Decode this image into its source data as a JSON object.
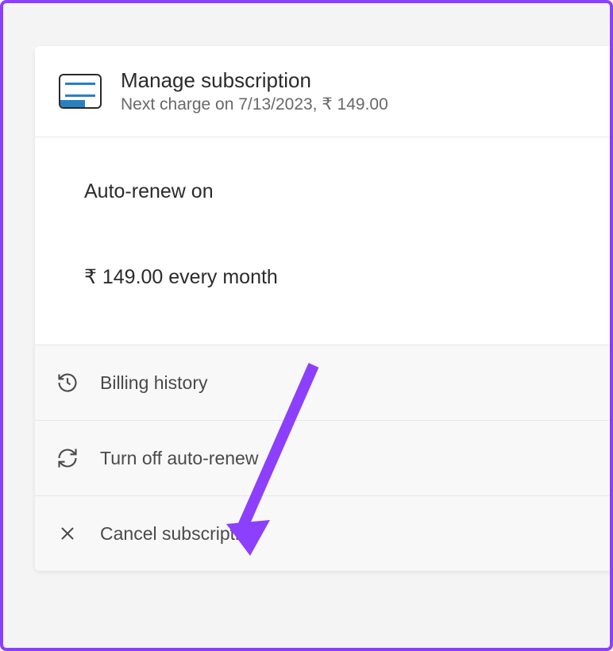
{
  "header": {
    "title": "Manage subscription",
    "subtitle": "Next charge on 7/13/2023, ₹ 149.00"
  },
  "info": {
    "autoRenewStatus": "Auto-renew on",
    "price": "₹ 149.00 every month"
  },
  "actions": {
    "billingHistory": "Billing history",
    "turnOffAutoRenew": "Turn off auto-renew",
    "cancelSubscription": "Cancel subscription"
  }
}
